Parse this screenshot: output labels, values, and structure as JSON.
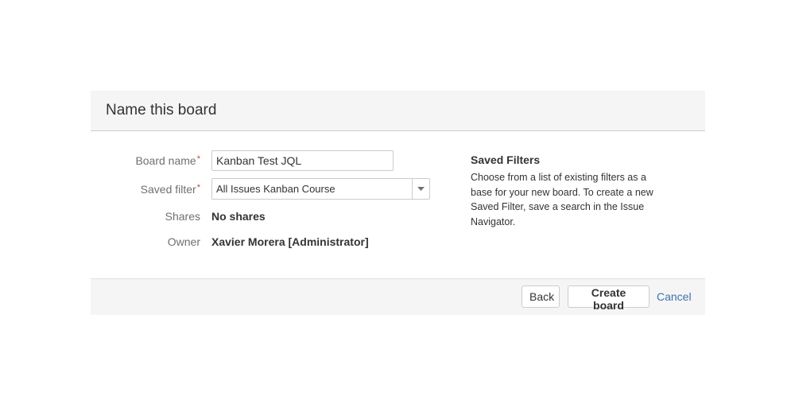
{
  "dialog": {
    "title": "Name this board"
  },
  "form": {
    "board_name": {
      "label": "Board name",
      "required_mark": "*",
      "value": "Kanban Test JQL"
    },
    "saved_filter": {
      "label": "Saved filter",
      "required_mark": "*",
      "selected": "All Issues Kanban Course"
    },
    "shares": {
      "label": "Shares",
      "value": "No shares"
    },
    "owner": {
      "label": "Owner",
      "value": "Xavier Morera [Administrator]"
    }
  },
  "help": {
    "title": "Saved Filters",
    "text": "Choose from a list of existing filters as a base for your new board. To create a new Saved Filter, save a search in the Issue Navigator."
  },
  "footer": {
    "back_label": "Back",
    "create_label": "Create board",
    "cancel_label": "Cancel"
  },
  "colors": {
    "required": "#d04437",
    "link": "#3b73af",
    "header_bg": "#f5f5f5"
  },
  "icons": {
    "select_arrow": "chevron-down-icon"
  }
}
